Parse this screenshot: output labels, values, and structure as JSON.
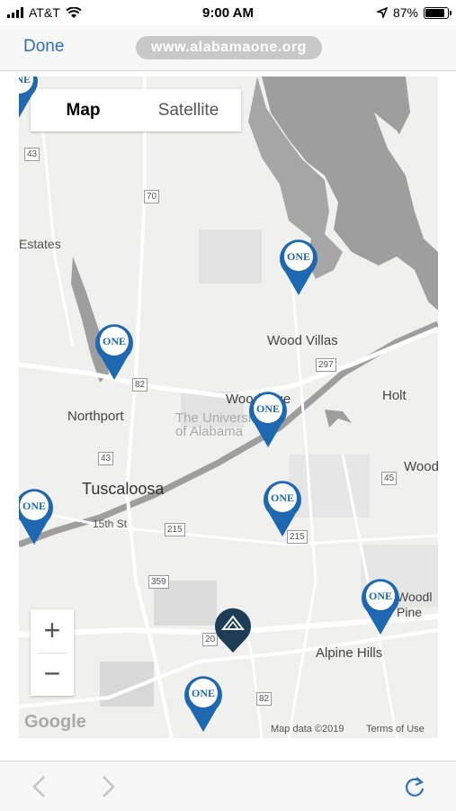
{
  "status": {
    "carrier": "AT&T",
    "time": "9:00 AM",
    "battery": "87%",
    "battery_level": 0.87
  },
  "nav": {
    "done": "Done",
    "url": "www.alabamaone.org"
  },
  "map": {
    "type_map": "Map",
    "type_satellite": "Satellite",
    "zoom_in": "+",
    "zoom_out": "−",
    "labels": {
      "estates": "Estates",
      "wood_villas": "Wood Villas",
      "northport": "Northport",
      "woodridge": "Woodridge",
      "holt": "Holt",
      "university": "The University of Alabama",
      "tuscaloosa": "Tuscaloosa",
      "fifteenth": "15th St",
      "wood": "Wood",
      "woodl_pine": "Woodl Pine",
      "alpine_hills": "Alpine Hills"
    },
    "shields": [
      "43",
      "70",
      "297",
      "82",
      "43",
      "45",
      "215",
      "215",
      "359",
      "20",
      "82"
    ],
    "pin_label": "ONE",
    "google": "Google",
    "map_data": "Map data ©2019",
    "terms": "Terms of Use"
  },
  "colors": {
    "pin": "#1e68b2",
    "link": "#2f6fc0",
    "water": "#9e9e9e"
  }
}
